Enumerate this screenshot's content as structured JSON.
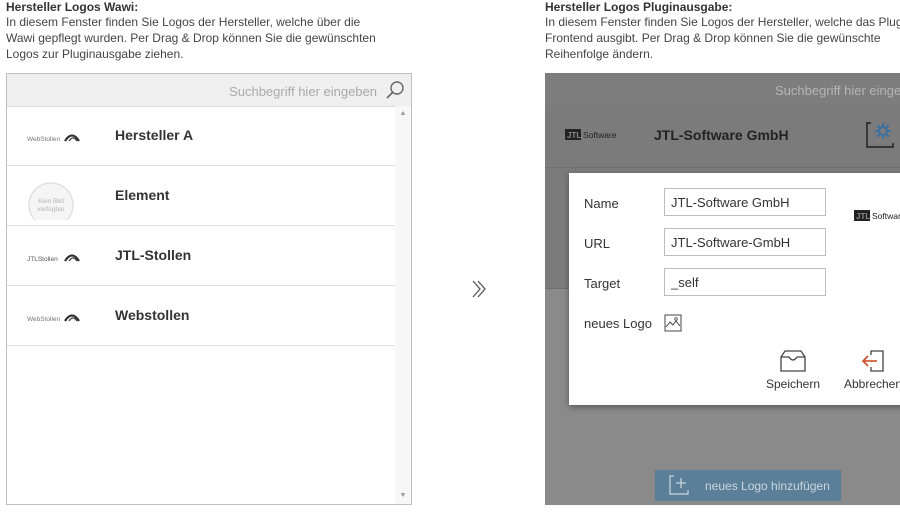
{
  "left": {
    "title": "Hersteller Logos Wawi:",
    "desc_lines": [
      "In diesem Fenster finden Sie Logos der Hersteller, welche über die",
      "Wawi gepflegt wurden. Per Drag & Drop können Sie die gewünschten",
      "Logos zur Pluginausgabe ziehen."
    ],
    "search_placeholder": "Suchbegriff hier eingeben",
    "items": [
      {
        "name": "Hersteller A",
        "logo_text": "WebStollen"
      },
      {
        "name": "Element",
        "logo_text_1": "Kein Bild",
        "logo_text_2": "verfügbar"
      },
      {
        "name": "JTL-Stollen",
        "logo_text": "JTLStollen"
      },
      {
        "name": "Webstollen",
        "logo_text": "WebStollen"
      }
    ]
  },
  "right": {
    "title": "Hersteller Logos Pluginausgabe:",
    "desc_lines": [
      "In diesem Fenster finden Sie Logos der Hersteller, welche das Plugin im",
      "Frontend ausgibt. Per Drag & Drop können Sie die gewünschte",
      "Reihenfolge ändern."
    ],
    "search_placeholder": "Suchbegriff hier eingeben",
    "row": {
      "name": "JTL-Software GmbH",
      "logo_text": "Software"
    },
    "add_button": "neues Logo hinzufügen"
  },
  "dialog": {
    "name_label": "Name",
    "name_value": "JTL-Software GmbH",
    "url_label": "URL",
    "url_value": "JTL-Software-GmbH",
    "target_label": "Target",
    "target_value": "_self",
    "logo_label": "neues Logo",
    "logo_text": "Software",
    "save_label": "Speichern",
    "cancel_label": "Abbrechen"
  },
  "colors": {
    "accent": "#5b7f98",
    "cancel_icon": "#d0502a"
  }
}
